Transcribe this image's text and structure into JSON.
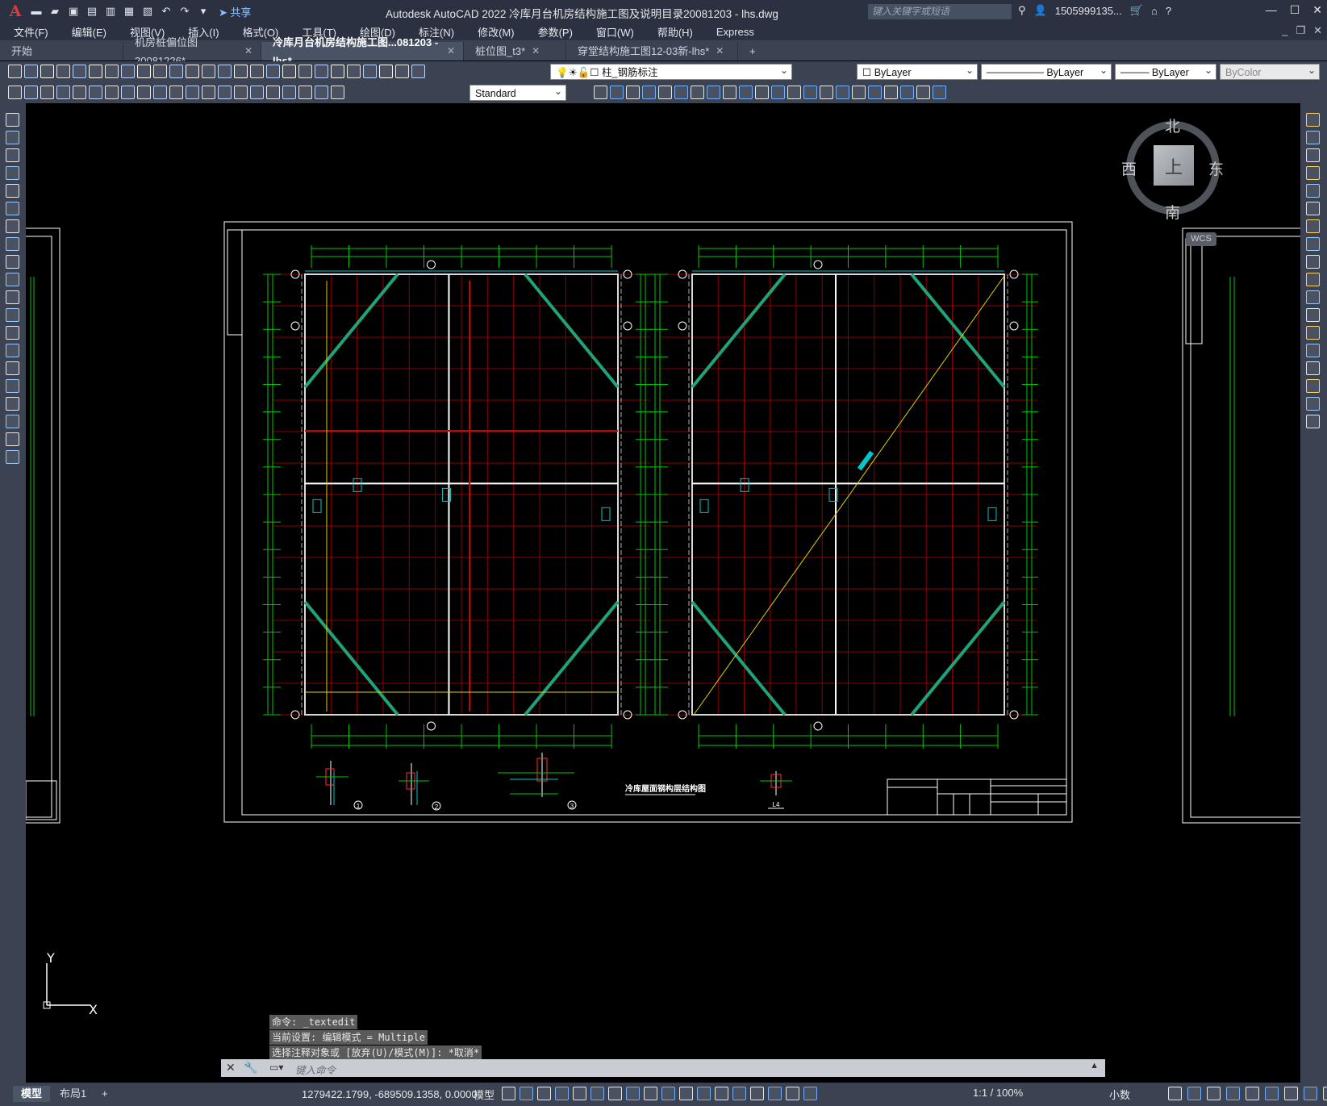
{
  "app": {
    "logo": "A",
    "window_title": "Autodesk AutoCAD 2022    冷库月台机房结构施工图及说明目录20081203 - lhs.dwg",
    "share_label": "共享",
    "search_placeholder": "键入关键字或短语",
    "user": "1505999135...",
    "quick_access_icons": [
      "new-file-icon",
      "open-icon",
      "save-icon",
      "save-as-icon",
      "plot-icon",
      "publish-icon",
      "print-icon",
      "undo-icon",
      "redo-icon",
      "dropdown-icon"
    ]
  },
  "menu": [
    "文件(F)",
    "编辑(E)",
    "视图(V)",
    "插入(I)",
    "格式(O)",
    "工具(T)",
    "绘图(D)",
    "标注(N)",
    "修改(M)",
    "参数(P)",
    "窗口(W)",
    "帮助(H)",
    "Express"
  ],
  "tabs": [
    {
      "label": "开始",
      "close": ""
    },
    {
      "label": "机房桩偏位图20081226*",
      "close": "✕"
    },
    {
      "label": "冷库月台机房结构施工图...081203 - lhs*",
      "close": "✕"
    },
    {
      "label": "桩位图_t3*",
      "close": "✕"
    },
    {
      "label": "穿堂结构施工图12-03新-lhs*",
      "close": "✕"
    }
  ],
  "new_tab_label": "+",
  "toolbar": {
    "layer_dropdown": "柱_钢筋标注",
    "color_dropdown": "ByLayer",
    "linetype_dropdown": "ByLayer",
    "lineweight_dropdown": "ByLayer",
    "plotstyle_dropdown": "ByColor",
    "textstyle_dropdown": "Standard"
  },
  "viewcube": {
    "north": "北",
    "south": "南",
    "east": "东",
    "west": "西",
    "face": "上",
    "wcs": "WCS"
  },
  "drawing": {
    "plan_title": "冷库屋面钢构层结构图",
    "detail_marks": [
      "1",
      "2",
      "3"
    ],
    "detail_label": "L4"
  },
  "command": {
    "history": [
      "命令: _textedit",
      "当前设置: 编辑模式 = Multiple",
      "选择注释对象或 [放弃(U)/模式(M)]: *取消*"
    ],
    "placeholder": "键入命令"
  },
  "ucs": {
    "x": "X",
    "y": "Y"
  },
  "status": {
    "layouts": [
      "模型",
      "布局1",
      "+"
    ],
    "coordinates": "1279422.1799, -689509.1358, 0.0000",
    "model_label": "模型",
    "scale": "1:1 / 100%",
    "units": "小数"
  },
  "colors": {
    "titlebar": "#2b3140",
    "toolbar": "#3b4353",
    "canvas": "#000000",
    "grid_red": "#8a0000",
    "green": "#00c800",
    "cyan": "#00c8c8",
    "diag": "#1fa37a",
    "yellow": "#ffff00",
    "white": "#ffffff"
  }
}
